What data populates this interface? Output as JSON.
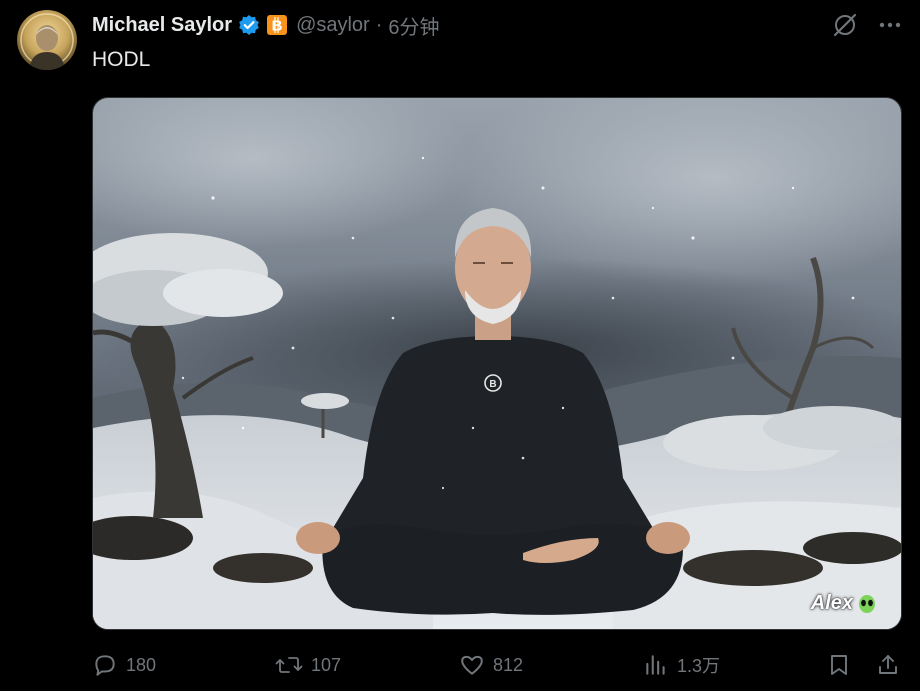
{
  "tweet": {
    "author_name": "Michael Saylor",
    "handle": "@saylor",
    "separator": "·",
    "time": "6分钟",
    "text": "HODL"
  },
  "badges": [
    "verified-badge-icon",
    "bitcoin-affiliate-badge-icon"
  ],
  "media": {
    "watermark": "Alex"
  },
  "actions": {
    "replies": "180",
    "retweets": "107",
    "likes": "812",
    "views": "1.3万"
  },
  "colors": {
    "background": "#000000",
    "primary_text": "#e7e9ea",
    "secondary_text": "#71767b",
    "verified": "#1d9bf0",
    "bitcoin_badge": "#f7931a"
  }
}
